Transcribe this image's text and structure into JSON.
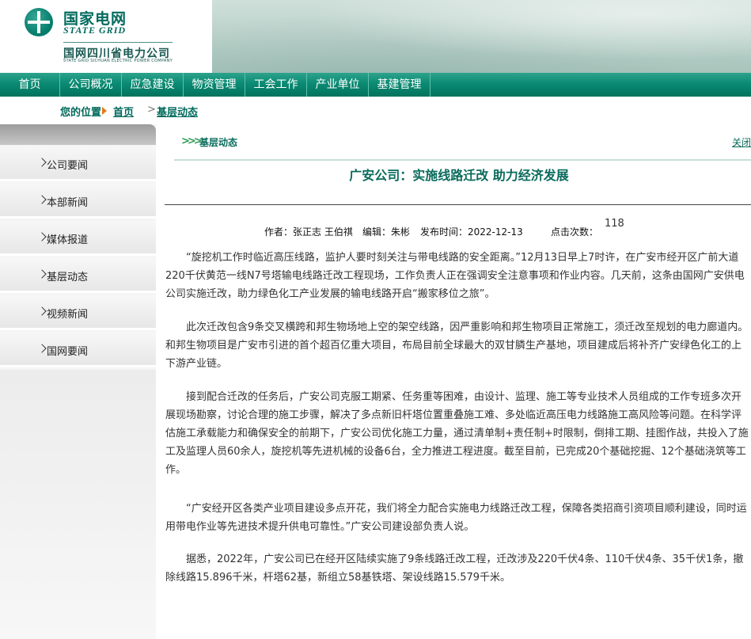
{
  "header": {
    "brand_cn": "国家电网",
    "brand_en": "STATE GRID",
    "company_cn": "国网四川省电力公司",
    "company_en": "STATE GRID SICHUAN ELECTRIC POWER COMPANY"
  },
  "nav": {
    "items": [
      "首页",
      "公司概况",
      "应急建设",
      "物资管理",
      "工会工作",
      "产业单位",
      "基建管理"
    ]
  },
  "breadcrumb": {
    "label": "您的位置",
    "home": "首页",
    "current": "基层动态"
  },
  "sidebar": {
    "items": [
      "公司要闻",
      "本部新闻",
      "媒体报道",
      "基层动态",
      "视频新闻",
      "国网要闻"
    ]
  },
  "section": {
    "title": "基层动态",
    "close": "关闭"
  },
  "article": {
    "title": "广安公司：实施线路迁改 助力经济发展",
    "meta": {
      "author": "作者：张正志 王伯祺",
      "editor": "编辑：朱彬",
      "date": "发布时间：2022-12-13",
      "hits_label": "点击次数：",
      "hits": "118"
    },
    "paragraphs": [
      "“旋挖机工作时临近高压线路，监护人要时刻关注与带电线路的安全距离。”12月13日早上7时许，在广安市经开区广前大道220千伏黄范一线N7号塔输电线路迁改工程现场，工作负责人正在强调安全注意事项和作业内容。几天前，这条由国网广安供电公司实施迁改，助力绿色化工产业发展的输电线路开启“搬家移位之旅”。",
      "此次迁改包含9条交叉横跨和邦生物场地上空的架空线路，因严重影响和邦生物项目正常施工，须迁改至规划的电力廊道内。和邦生物项目是广安市引进的首个超百亿重大项目，布局目前全球最大的双甘膦生产基地，项目建成后将补齐广安绿色化工的上下游产业链。",
      "接到配合迁改的任务后，广安公司克服工期紧、任务重等困难，由设计、监理、施工等专业技术人员组成的工作专班多次开展现场勘察，讨论合理的施工步骤，解决了多点新旧杆塔位置重叠施工难、多处临近高压电力线路施工高风险等问题。在科学评估施工承载能力和确保安全的前期下，广安公司优化施工力量，通过清单制+责任制+时限制，倒排工期、挂图作战，共投入了施工及监理人员60余人，旋挖机等先进机械的设备6台，全力推进工程进度。截至目前，已完成20个基础挖掘、12个基础浇筑等工作。",
      "“广安经开区各类产业项目建设多点开花，我们将全力配合实施电力线路迁改工程，保障各类招商引资项目顺利建设，同时运用带电作业等先进技术提升供电可靠性。”广安公司建设部负责人说。",
      "据悉，2022年，广安公司已在经开区陆续实施了9条线路迁改工程，迁改涉及220千伏4条、110千伏4条、35千伏1条，撤除线路15.896千米，杆塔62基，新组立58基铁塔、架设线路15.579千米。"
    ]
  },
  "colors": {
    "brand_green": "#006a5c",
    "nav_green": "#0b8a73",
    "crumb_arrow": "#e07b1c"
  }
}
